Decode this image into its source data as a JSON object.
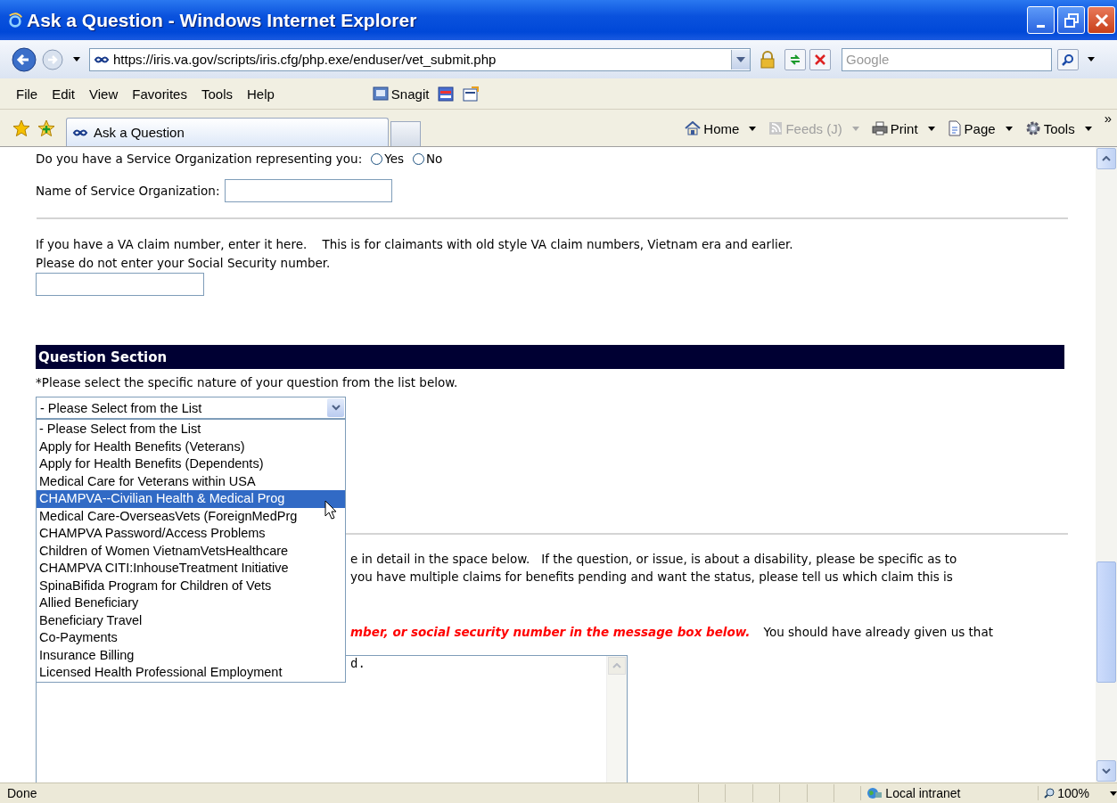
{
  "window": {
    "title": "Ask a Question - Windows Internet Explorer"
  },
  "address_bar": {
    "url": "https://iris.va.gov/scripts/iris.cfg/php.exe/enduser/vet_submit.php"
  },
  "search": {
    "placeholder": "Google"
  },
  "menu": [
    "File",
    "Edit",
    "View",
    "Favorites",
    "Tools",
    "Help"
  ],
  "snagit_label": "Snagit",
  "tabs": [
    {
      "label": "Ask a Question",
      "selected": true
    }
  ],
  "command_bar": [
    {
      "label": "Home",
      "kind": "home",
      "disabled": false
    },
    {
      "label": "Feeds (J)",
      "kind": "feeds",
      "disabled": true
    },
    {
      "label": "Print",
      "kind": "print",
      "disabled": false
    },
    {
      "label": "Page",
      "kind": "page",
      "disabled": false
    },
    {
      "label": "Tools",
      "kind": "tools",
      "disabled": false
    }
  ],
  "command_more": "»",
  "form": {
    "service_org_question": "Do you have a Service Organization representing you:",
    "service_org_options": [
      {
        "label": "Yes",
        "selected": false
      },
      {
        "label": "No",
        "selected": false
      }
    ],
    "service_org_name_label": "Name of Service Organization:",
    "claim_text": [
      "If you have a VA claim number, enter it here.    This is for claimants with old style VA claim numbers, Vietnam era and earlier.",
      "Please do not enter your Social Security number."
    ],
    "section_title": "Question Section",
    "instruction": "*Please select the specific nature of your question from the list below.",
    "select_value": "- Please Select from the List",
    "options": [
      {
        "label": "- Please Select from the List",
        "selected": false
      },
      {
        "label": "Apply for Health Benefits (Veterans)",
        "selected": false
      },
      {
        "label": "Apply for Health Benefits (Dependents)",
        "selected": false
      },
      {
        "label": "Medical Care for Veterans within USA",
        "selected": false
      },
      {
        "label": "CHAMPVA--Civilian Health & Medical Prog",
        "selected": true
      },
      {
        "label": "Medical Care-OverseasVets (ForeignMedPrg",
        "selected": false
      },
      {
        "label": "CHAMPVA Password/Access Problems",
        "selected": false
      },
      {
        "label": "Children of Women VietnamVetsHealthcare",
        "selected": false
      },
      {
        "label": "CHAMPVA CITI:InhouseTreatment Initiative",
        "selected": false
      },
      {
        "label": "SpinaBifida Program for Children of Vets",
        "selected": false
      },
      {
        "label": "Allied Beneficiary",
        "selected": false
      },
      {
        "label": "Beneficiary Travel",
        "selected": false
      },
      {
        "label": "Co-Payments",
        "selected": false
      },
      {
        "label": "Insurance Billing",
        "selected": false
      },
      {
        "label": "Licensed Health Professional Employment",
        "selected": false
      }
    ],
    "detail_text": [
      "e in detail in the space below.   If the question, or issue, is about a disability, please be specific as to",
      "you have multiple claims for benefits pending and want the status, please tell us which claim this is"
    ],
    "warning_text": "mber, or social security number in the message box below.",
    "warning_after": "You should have already given us that",
    "message_value": "d."
  },
  "status_bar": {
    "text": "Done",
    "zone": "Local intranet",
    "zoom": "100%"
  }
}
